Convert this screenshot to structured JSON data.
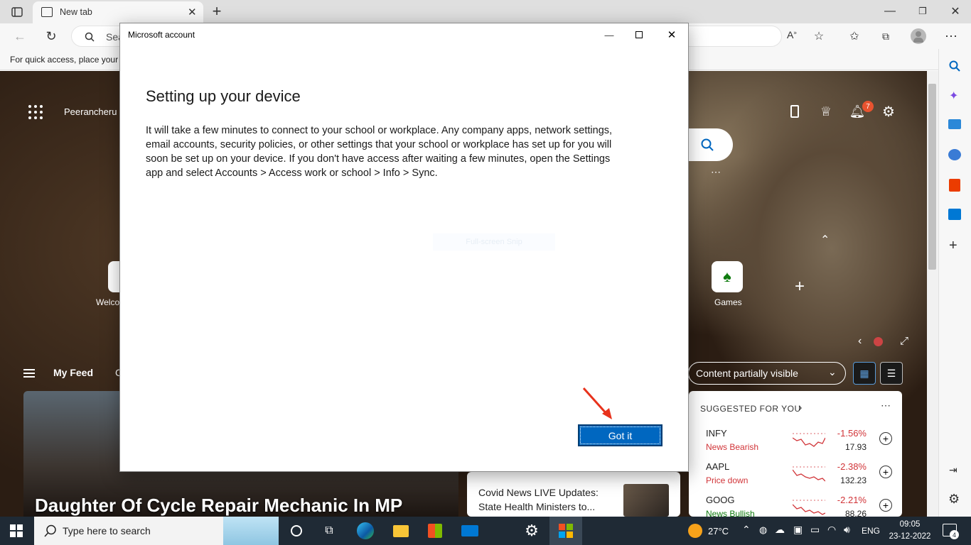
{
  "browser": {
    "tab_title": "New tab",
    "address_placeholder": "Sea",
    "favbar_text": "For quick access, place your"
  },
  "page": {
    "location": "Peerancheru",
    "notif_count": "7",
    "feed_title": "My Feed",
    "feed_next_letter": "C",
    "content_toggle": "Content partially visible",
    "quicklinks": [
      {
        "label": "Welco"
      },
      {
        "label": "Games"
      }
    ],
    "headline": "Daughter Of Cycle Repair Mechanic In MP",
    "news_card": "Covid News LIVE Updates: State Health Ministers to...",
    "stocks": {
      "header": "SUGGESTED FOR YOU",
      "items": [
        {
          "ticker": "INFY",
          "sub": "News Bearish",
          "change": "-1.56%",
          "price": "17.93"
        },
        {
          "ticker": "AAPL",
          "sub": "Price down",
          "change": "-2.38%",
          "price": "132.23"
        },
        {
          "ticker": "GOOG",
          "sub": "News Bullish",
          "change": "-2.21%",
          "price": "88.26"
        }
      ]
    }
  },
  "dialog": {
    "title": "Microsoft account",
    "heading": "Setting up your device",
    "body": "It will take a few minutes to connect to your school or workplace. Any company apps, network settings, email accounts, security policies, or other settings that your school or workplace has set up for you will soon be set up on your device. If you don't have access after waiting a few minutes, open the Settings app and select Accounts > Access work or school > Info > Sync.",
    "snip_text": "Full-screen Snip",
    "button": "Got it"
  },
  "taskbar": {
    "search_placeholder": "Type here to search",
    "temperature": "27°C",
    "language": "ENG",
    "time": "09:05",
    "date": "23-12-2022",
    "notifications": "4"
  },
  "colors": {
    "accent": "#0067c0",
    "negative": "#d13438",
    "taskbar": "#1f2a35"
  }
}
